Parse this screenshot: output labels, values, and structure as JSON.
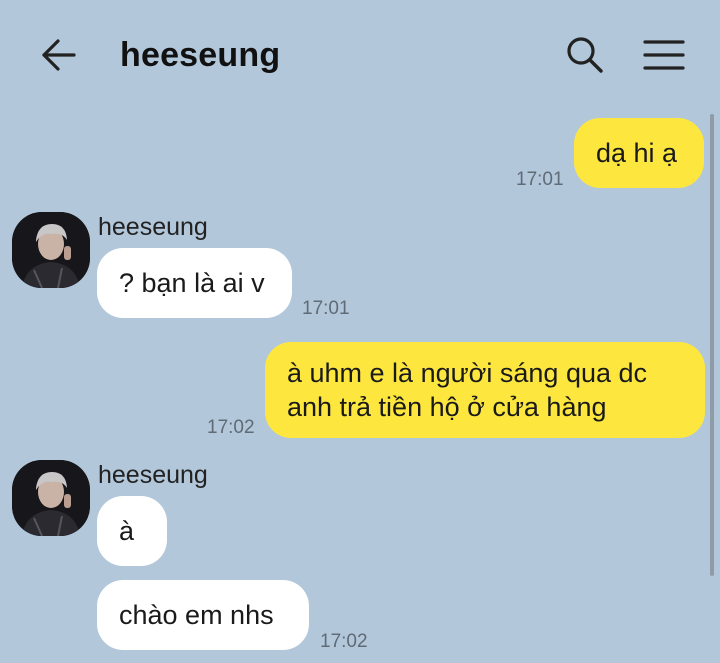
{
  "header": {
    "title": "heeseung",
    "back_icon": "arrow-left-icon",
    "search_icon": "search-icon",
    "menu_icon": "hamburger-menu-icon"
  },
  "colors": {
    "background": "#b2c7da",
    "my_bubble": "#fde73f",
    "their_bubble": "#ffffff"
  },
  "messages": [
    {
      "from": "me",
      "text": "dạ hi ạ",
      "time": "17:01"
    },
    {
      "from": "them",
      "sender": "heeseung",
      "text": "? bạn là ai v",
      "time": "17:01"
    },
    {
      "from": "me",
      "lines": [
        "à uhm e là người sáng qua dc",
        "anh trả tiền hộ ở cửa hàng"
      ],
      "time": "17:02"
    },
    {
      "from": "them",
      "sender": "heeseung",
      "text": "à"
    },
    {
      "from": "them",
      "text": "chào em nhs",
      "time": "17:02"
    }
  ]
}
